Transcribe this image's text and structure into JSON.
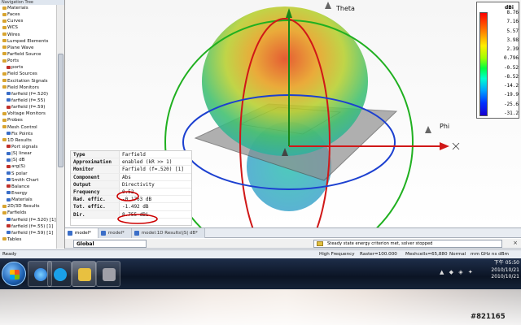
{
  "nav": {
    "title": "Navigation Tree",
    "items": [
      {
        "label": "Materials",
        "level": 1
      },
      {
        "label": "Faces",
        "level": 1
      },
      {
        "label": "Curves",
        "level": 1
      },
      {
        "label": "WCS",
        "level": 1
      },
      {
        "label": "Wires",
        "level": 1
      },
      {
        "label": "Lumped Elements",
        "level": 1
      },
      {
        "label": "Plane Wave",
        "level": 1
      },
      {
        "label": "Farfield Source",
        "level": 1
      },
      {
        "label": "Ports",
        "level": 1
      },
      {
        "label": "ports",
        "level": 2
      },
      {
        "label": "Field Sources",
        "level": 1
      },
      {
        "label": "Excitation Signals",
        "level": 1
      },
      {
        "label": "Field Monitors",
        "level": 1
      },
      {
        "label": "farfield (f=.520)",
        "level": 2
      },
      {
        "label": "farfield (f=.55)",
        "level": 2
      },
      {
        "label": "farfield (f=.59)",
        "level": 2
      },
      {
        "label": "Voltage Monitors",
        "level": 1
      },
      {
        "label": "Probes",
        "level": 1
      },
      {
        "label": "Mesh Control",
        "level": 1
      },
      {
        "label": "Fix Points",
        "level": 2
      },
      {
        "label": "1D Results",
        "level": 1
      },
      {
        "label": "Port signals",
        "level": 2
      },
      {
        "label": "|S| linear",
        "level": 2
      },
      {
        "label": "|S| dB",
        "level": 2
      },
      {
        "label": "arg(S)",
        "level": 2
      },
      {
        "label": "S polar",
        "level": 2
      },
      {
        "label": "Smith Chart",
        "level": 2
      },
      {
        "label": "Balance",
        "level": 2
      },
      {
        "label": "Energy",
        "level": 2
      },
      {
        "label": "Materials",
        "level": 2
      },
      {
        "label": "2D/3D Results",
        "level": 1
      },
      {
        "label": "Farfields",
        "level": 1
      },
      {
        "label": "farfield (f=.520) [1]",
        "level": 2
      },
      {
        "label": "farfield (f=.55) [1]",
        "level": 2
      },
      {
        "label": "farfield (f=.59) [1]",
        "level": 2
      },
      {
        "label": "Tables",
        "level": 1
      }
    ]
  },
  "view": {
    "axis_theta": "Theta",
    "axis_phi": "Phi",
    "highlight_color": "#cc0000"
  },
  "info": {
    "rows": [
      {
        "key": "Type",
        "value": "Farfield"
      },
      {
        "key": "Approximation",
        "value": "enabled (kR >> 1)"
      },
      {
        "key": "Monitor",
        "value": "Farfield (f=.520) [1]"
      },
      {
        "key": "Component",
        "value": "Abs"
      },
      {
        "key": "Output",
        "value": "Directivity"
      },
      {
        "key": "Frequency",
        "value": "0.52"
      },
      {
        "key": "Rad. effic.",
        "value": "-0.1763 dB"
      },
      {
        "key": "Tot. effic.",
        "value": "-1.492 dB"
      },
      {
        "key": "Dir.",
        "value": "8.755 dBi"
      }
    ]
  },
  "legend": {
    "unit": "dBi",
    "values": [
      "8.76",
      "7.16",
      "5.57",
      "3.98",
      "2.39",
      "0.796",
      "-0.52",
      "-8.52",
      "-14.2",
      "-19.9",
      "-25.6",
      "-31.2"
    ]
  },
  "tabs": [
    {
      "label": "model*",
      "active": true
    },
    {
      "label": "model*",
      "active": false
    },
    {
      "label": "model:1D Results\\|S| dB*",
      "active": false
    }
  ],
  "lower": {
    "global_label": "Global",
    "message": "Steady state energy criterion met, solver stopped",
    "close": "×"
  },
  "status": {
    "ready": "Ready",
    "mode": "High Frequency",
    "raster": "Raster=100.000",
    "meshcells": "Meshcells=65,880",
    "normal": "Normal",
    "units": "mm  GHz  ns  dBm"
  },
  "taskbar": {
    "tray": "▲ ◆ ◈ ✦",
    "clock_lines": [
      "下午 05:50",
      "2010/10/21",
      "2010/10/21"
    ]
  },
  "watermark": "#821165"
}
